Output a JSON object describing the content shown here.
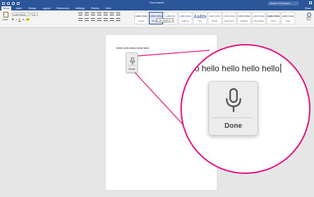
{
  "window": {
    "document_title": "Document1",
    "search_placeholder": "Search in Document",
    "share_label": "Share"
  },
  "tabs": [
    "Home",
    "Insert",
    "Design",
    "Layout",
    "References",
    "Mailings",
    "Review",
    "View"
  ],
  "ribbon": {
    "paste_label": "Paste",
    "font_name": "Calibri (Body)",
    "font_size": "12",
    "styles": [
      {
        "sample": "AaBbCcDdEe",
        "name": "Normal"
      },
      {
        "sample": "AaBbCcDdEe",
        "name": "No Spacing"
      },
      {
        "sample": "AaBbCcDc",
        "name": "Heading 1"
      },
      {
        "sample": "AaBbCcDdE",
        "name": "Heading 2"
      },
      {
        "sample": "AaBbC",
        "name": "Title"
      },
      {
        "sample": "AaBbCcDdE",
        "name": "Subtitle"
      },
      {
        "sample": "AaBbCcDdEe",
        "name": "Subtle Emph."
      },
      {
        "sample": "AaBbCcDdEe",
        "name": "Emphasis"
      },
      {
        "sample": "AaBbCcDdEe",
        "name": "Intense Emph."
      },
      {
        "sample": "AaBbCcDdEe",
        "name": "Strong"
      },
      {
        "sample": "AaBbCcDdEe",
        "name": "Quote"
      }
    ],
    "style_tooltip": "No Spacing",
    "styles_pane_label": "Styles Pane"
  },
  "document": {
    "body_text": "Hello hello hello hello hello",
    "magnified_text": "llo hello hello hello hello"
  },
  "dictation": {
    "done_label": "Done"
  },
  "colors": {
    "word_blue": "#2b579a",
    "highlight_magenta": "#e3157e"
  }
}
